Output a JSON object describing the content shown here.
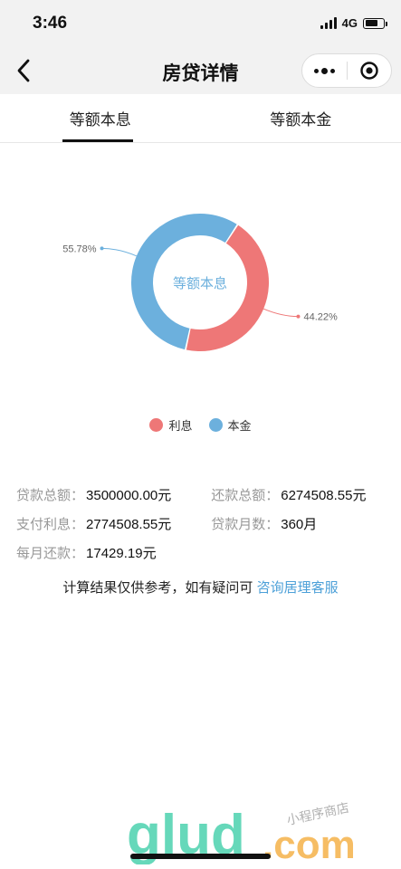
{
  "status": {
    "time": "3:46",
    "network": "4G"
  },
  "nav": {
    "title": "房贷详情"
  },
  "tabs": [
    {
      "label": "等额本息",
      "active": true
    },
    {
      "label": "等额本金",
      "active": false
    }
  ],
  "chart_data": {
    "type": "pie",
    "center_label": "等额本息",
    "slices": [
      {
        "name": "利息",
        "value": 44.22,
        "label": "44.22%",
        "color": "#ee7777"
      },
      {
        "name": "本金",
        "value": 55.78,
        "label": "55.78%",
        "color": "#6cb0dd"
      }
    ],
    "legend": [
      "利息",
      "本金"
    ],
    "legend_position": "bottom"
  },
  "info": {
    "loan_total_label": "贷款总额：",
    "loan_total_value": "3500000.00元",
    "repay_total_label": "还款总额：",
    "repay_total_value": "6274508.55元",
    "interest_label": "支付利息：",
    "interest_value": "2774508.55元",
    "months_label": "贷款月数：",
    "months_value": "360月",
    "monthly_label": "每月还款：",
    "monthly_value": "17429.19元"
  },
  "note": {
    "text": "计算结果仅供参考，如有疑问可 ",
    "link": "咨询居理客服"
  },
  "watermark": {
    "brand": "glud",
    "suffix": ".com",
    "tagline": "小程序商店"
  }
}
